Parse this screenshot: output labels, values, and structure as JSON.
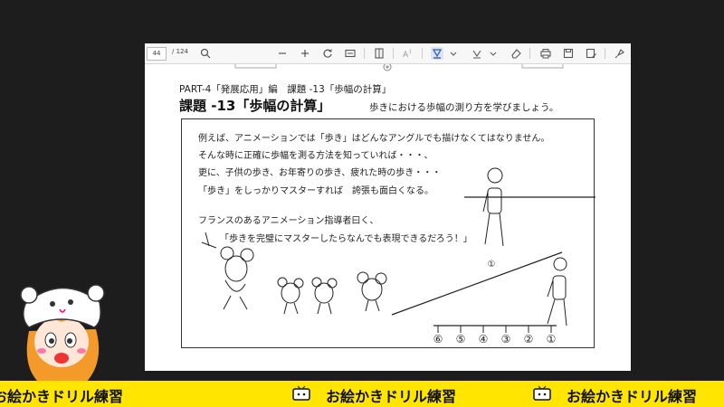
{
  "toolbar": {
    "page_number": "44",
    "page_total": "/ 124",
    "icons": [
      "search-icon",
      "zoom-out-icon",
      "zoom-in-icon",
      "rotate-icon",
      "fit-page-icon",
      "page-view-icon",
      "read-aloud-icon",
      "highlight-icon",
      "draw-icon",
      "eraser-icon",
      "print-icon",
      "save-icon",
      "save-as-icon",
      "pin-icon"
    ]
  },
  "page": {
    "header_small": "PART-4「発展応用」編　課題 -13「歩幅の計算」",
    "title": "課題 -13「歩幅の計算」",
    "subtitle": "歩きにおける歩幅の測り方を学びましょう。",
    "lines": [
      "例えば、アニメーションでは「歩き」はどんなアングルでも描けなくてはなりません。",
      "そんな時に正確に歩幅を測る方法を知っていれば・・・、",
      "更に、子供の歩き、お年寄りの歩き、疲れた時の歩き・・・",
      "「歩き」をしっかりマスターすれば　誇張も面白くなる。",
      "フランスのあるアニメーション指導者曰く、",
      "「歩きを完璧にマスターしたらなんでも表現できるだろう！」"
    ],
    "markers": [
      "⑥",
      "⑤",
      "④",
      "③",
      "②",
      "①"
    ],
    "slope_marker": "①"
  },
  "ticker": {
    "text": "お絵かきドリル練習",
    "colors": {
      "bg": "#ffe500",
      "text": "#111111"
    }
  }
}
